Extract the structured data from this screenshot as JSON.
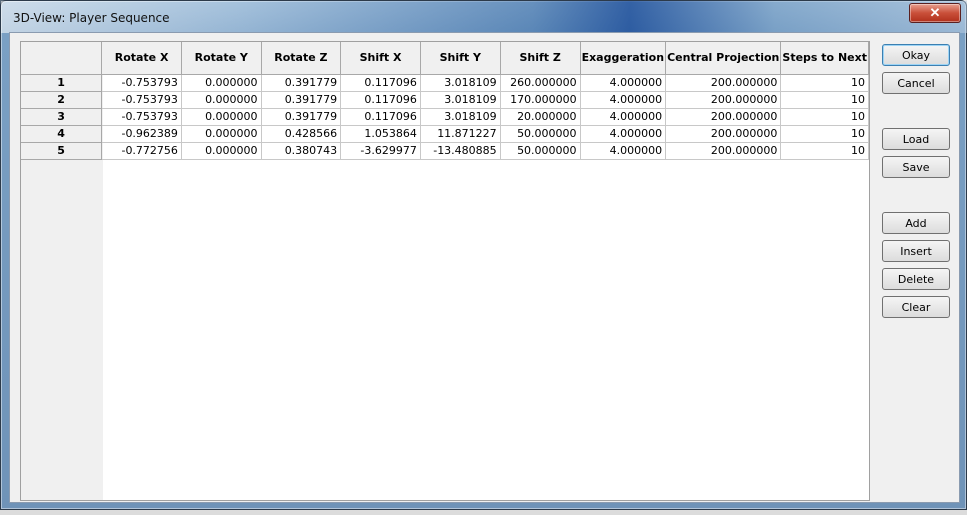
{
  "window": {
    "title": "3D-View: Player Sequence",
    "close_glyph": "✕"
  },
  "table": {
    "columns": [
      "Rotate X",
      "Rotate Y",
      "Rotate Z",
      "Shift X",
      "Shift Y",
      "Shift Z",
      "Exaggeration",
      "Central Projection",
      "Steps to Next"
    ],
    "rows": [
      {
        "label": "1",
        "cells": [
          "-0.753793",
          "0.000000",
          "0.391779",
          "0.117096",
          "3.018109",
          "260.000000",
          "4.000000",
          "200.000000",
          "10"
        ]
      },
      {
        "label": "2",
        "cells": [
          "-0.753793",
          "0.000000",
          "0.391779",
          "0.117096",
          "3.018109",
          "170.000000",
          "4.000000",
          "200.000000",
          "10"
        ]
      },
      {
        "label": "3",
        "cells": [
          "-0.753793",
          "0.000000",
          "0.391779",
          "0.117096",
          "3.018109",
          "20.000000",
          "4.000000",
          "200.000000",
          "10"
        ]
      },
      {
        "label": "4",
        "cells": [
          "-0.962389",
          "0.000000",
          "0.428566",
          "1.053864",
          "11.871227",
          "50.000000",
          "4.000000",
          "200.000000",
          "10"
        ]
      },
      {
        "label": "5",
        "cells": [
          "-0.772756",
          "0.000000",
          "0.380743",
          "-3.629977",
          "-13.480885",
          "50.000000",
          "4.000000",
          "200.000000",
          "10"
        ]
      }
    ]
  },
  "buttons": {
    "okay": "Okay",
    "cancel": "Cancel",
    "load": "Load",
    "save": "Save",
    "add": "Add",
    "insert": "Insert",
    "delete": "Delete",
    "clear": "Clear"
  }
}
